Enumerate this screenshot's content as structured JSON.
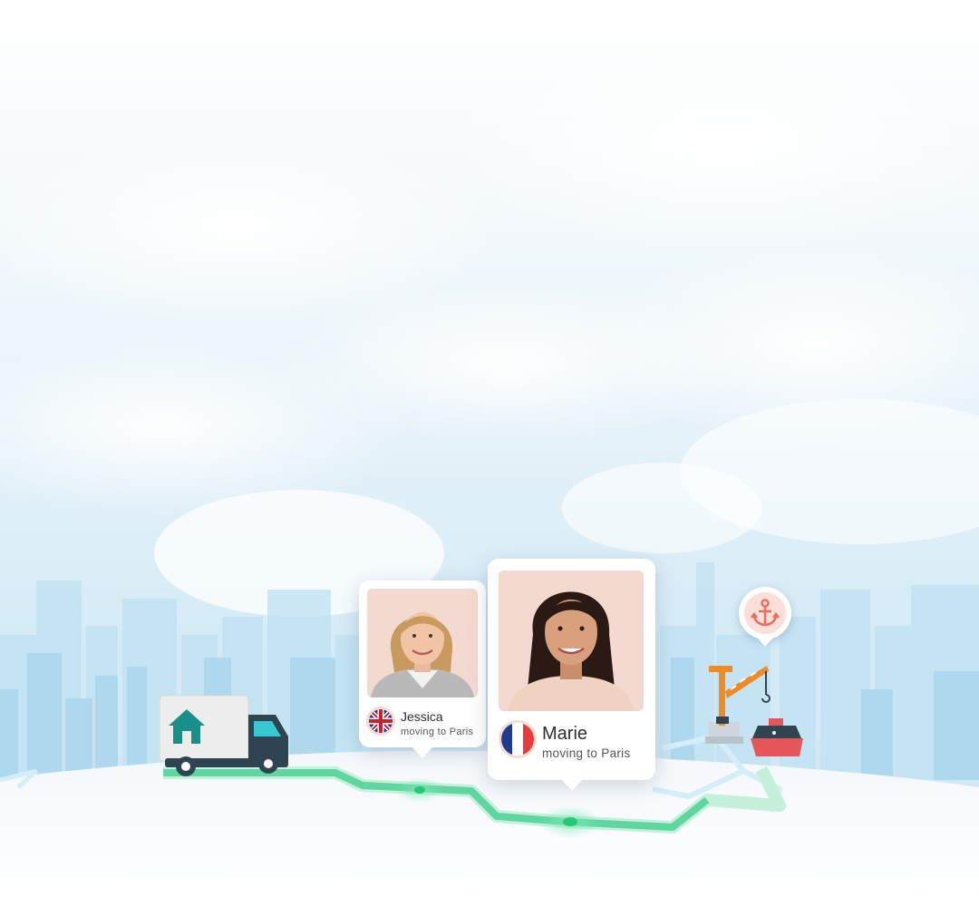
{
  "people": [
    {
      "name": "Jessica",
      "subtitle": "moving to Paris",
      "flag": "uk-flag-icon"
    },
    {
      "name": "Marie",
      "subtitle": "moving to Paris",
      "flag": "france-flag-icon"
    }
  ],
  "icons": {
    "truck": "moving-truck-icon",
    "home": "home-icon",
    "anchor": "anchor-icon",
    "crane": "port-crane-icon",
    "ship": "cargo-ship-icon"
  },
  "colors": {
    "route": "#5fd6a0",
    "route_dot": "#27c77a",
    "anchor_accent": "#ef6d5e",
    "truck_teal": "#1a8f8a",
    "truck_cab": "#37c9d3",
    "crane_orange": "#f08a24",
    "ship_red": "#e5575a"
  }
}
